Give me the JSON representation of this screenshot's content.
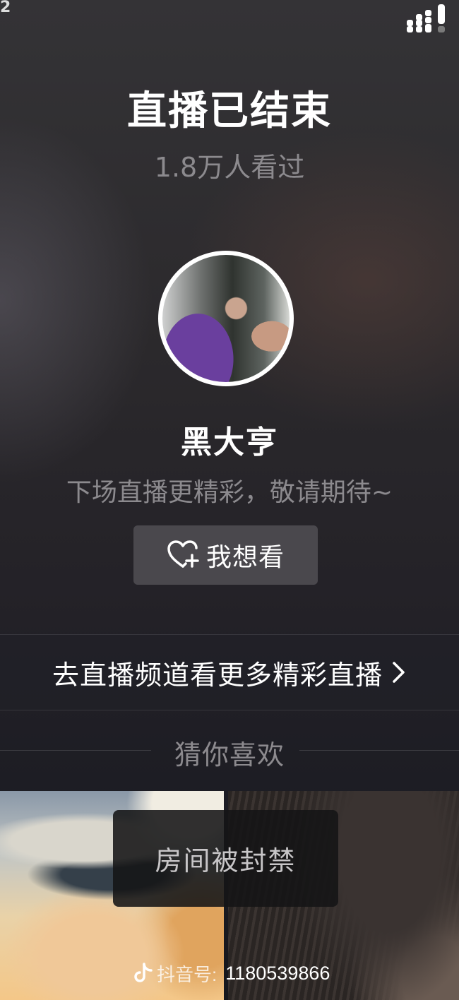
{
  "status_bar": {
    "corner_char": "2",
    "icons": [
      "signal-dots-icon"
    ]
  },
  "live": {
    "title": "直播已结束",
    "viewers": "1.8万人看过"
  },
  "host": {
    "avatar": "host-avatar-photo",
    "nickname": "黑大亨",
    "slogan": "下场直播更精彩，敬请期待~"
  },
  "want_button": {
    "icon": "heart-plus-icon",
    "label": "我想看"
  },
  "channel": {
    "label": "去直播频道看更多精彩直播",
    "icon": "chevron-right-icon"
  },
  "guess": {
    "label": "猜你喜欢"
  },
  "cards": [
    {
      "overlay_label": "房间被封禁"
    },
    {
      "douyin_id_label": "抖音号:",
      "douyin_id": "1180539866",
      "icon": "douyin-logo-icon"
    }
  ],
  "colors": {
    "primary_text": "#ffffff",
    "secondary_text": "#8c8a8e",
    "button_bg": "#4a484d"
  }
}
